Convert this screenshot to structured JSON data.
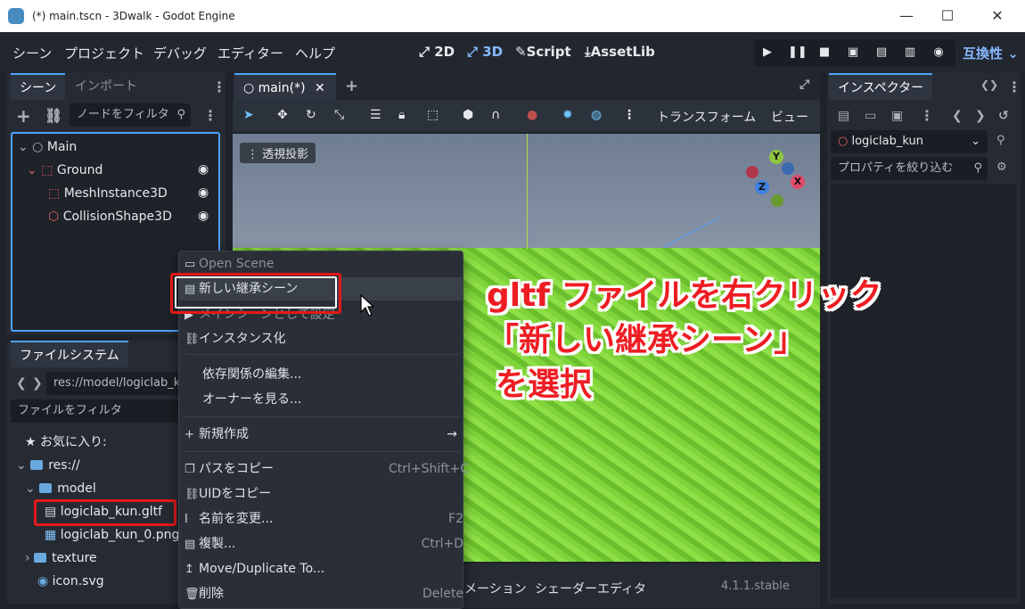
{
  "window": {
    "title": "(*) main.tscn - 3Dwalk - Godot Engine",
    "minimize": "—",
    "maximize": "☐",
    "close": "✕"
  },
  "menubar": {
    "items": [
      "シーン",
      "プロジェクト",
      "デバッグ",
      "エディター",
      "ヘルプ"
    ],
    "modes": [
      "2D",
      "3D",
      "Script",
      "AssetLib"
    ],
    "renderer": "互換性 ⌄"
  },
  "scene_dock": {
    "tabs": [
      "シーン",
      "インポート"
    ],
    "filter_placeholder": "ノードをフィルタ",
    "nodes": [
      "Main",
      "Ground",
      "MeshInstance3D",
      "CollisionShape3D"
    ]
  },
  "filesystem": {
    "tab": "ファイルシステム",
    "path": "res://model/logiclab_k",
    "filter_placeholder": "ファイルをフィルタ",
    "favorites": "お気に入り:",
    "items": [
      "res://",
      "model",
      "logiclab_kun.gltf",
      "logiclab_kun_0.png",
      "texture",
      "icon.svg"
    ]
  },
  "editor": {
    "tab": "main(*)",
    "add_tab": "+",
    "perspective_label": "透視投影",
    "transform_label": "トランスフォーム",
    "view_label": "ビュー",
    "bottom_items": [
      "メーション",
      "シェーダーエディタ"
    ],
    "version": "4.1.1.stable"
  },
  "gizmo": {
    "y": "Y",
    "x": "X",
    "z": "Z"
  },
  "inspector": {
    "tab": "インスペクター",
    "object": "logiclab_kun",
    "filter_placeholder": "プロパティを絞り込む"
  },
  "context_menu": {
    "items": [
      {
        "label": "Open Scene",
        "shortcut": ""
      },
      {
        "label": "新しい継承シーン",
        "shortcut": ""
      },
      {
        "label": "メインシーンとして設定",
        "shortcut": ""
      },
      {
        "label": "インスタンス化",
        "shortcut": ""
      },
      {
        "label": "依存関係の編集...",
        "shortcut": ""
      },
      {
        "label": "オーナーを見る...",
        "shortcut": ""
      },
      {
        "label": "新規作成",
        "shortcut": ""
      },
      {
        "label": "パスをコピー",
        "shortcut": "Ctrl+Shift+C"
      },
      {
        "label": "UIDをコピー",
        "shortcut": ""
      },
      {
        "label": "名前を変更...",
        "shortcut": "F2"
      },
      {
        "label": "複製...",
        "shortcut": "Ctrl+D"
      },
      {
        "label": "Move/Duplicate To...",
        "shortcut": ""
      },
      {
        "label": "削除",
        "shortcut": "Delete"
      }
    ]
  },
  "annotation": {
    "line1": "gltf ファイルを右クリック",
    "line2": "「新しい継承シーン」",
    "line3": "を選択"
  },
  "colors": {
    "accent": "#4ea3ff",
    "highlight": "#e41919",
    "annotation_text": "#ee1d23",
    "ground": "#7fd43a"
  }
}
